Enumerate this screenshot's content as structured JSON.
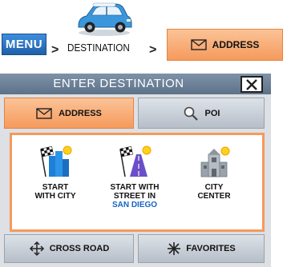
{
  "breadcrumb": {
    "menu_label": "MENU",
    "separator": ">",
    "destination_label": "DESTINATION",
    "address_label": "ADDRESS"
  },
  "dialog": {
    "title": "ENTER DESTINATION",
    "tabs": [
      {
        "label": "ADDRESS",
        "icon": "envelope-icon",
        "selected": true
      },
      {
        "label": "POI",
        "icon": "magnifier-icon",
        "selected": false
      }
    ],
    "options": [
      {
        "label": "START\nWITH CITY",
        "icon": "city-flag-icon"
      },
      {
        "label": "START WITH\nSTREET IN",
        "sub_label": "SAN DIEGO",
        "icon": "street-flag-icon"
      },
      {
        "label": "CITY\nCENTER",
        "icon": "city-center-icon"
      }
    ],
    "bottom_buttons": [
      {
        "label": "CROSS ROAD",
        "icon": "crossroad-arrows-icon"
      },
      {
        "label": "FAVORITES",
        "icon": "favorites-star-icon"
      }
    ]
  },
  "colors": {
    "menu_blue": "#2b74c7",
    "selected_orange": "#f59a5c",
    "title_bar": "#6f829a",
    "panel_bg": "#dde0e4",
    "street_name_blue": "#1763c4"
  }
}
